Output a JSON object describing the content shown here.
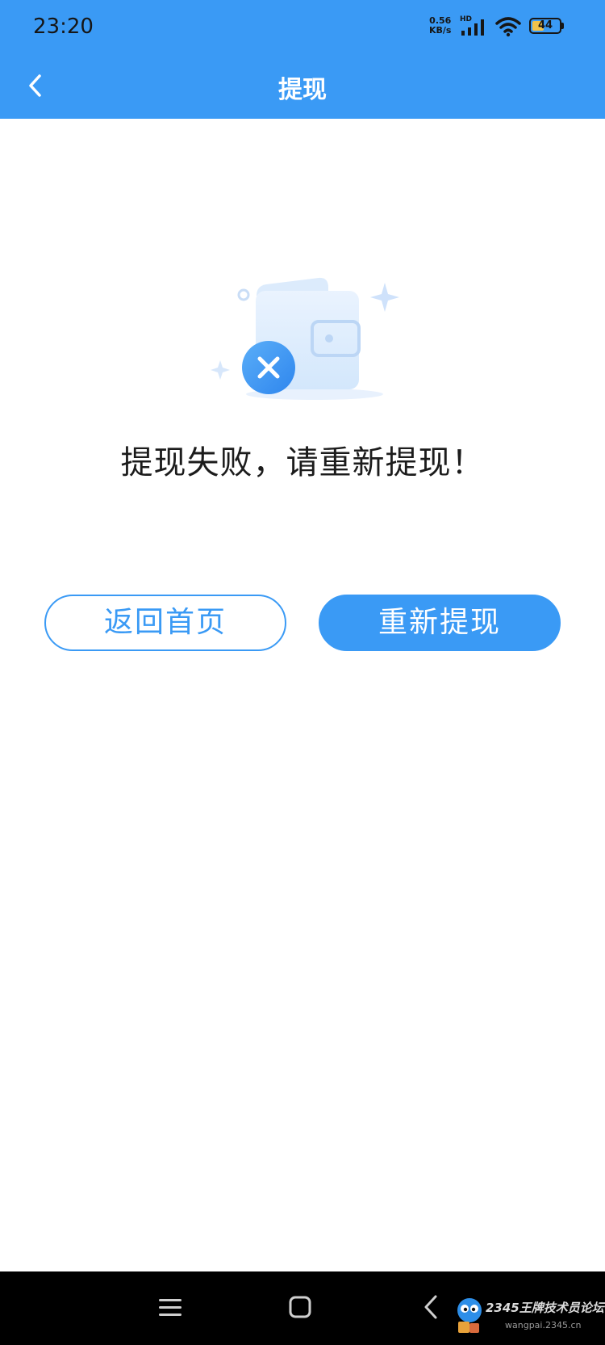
{
  "status_bar": {
    "time": "23:20",
    "net_speed_value": "0.56",
    "net_speed_unit": "KB/s",
    "network_type": "HD",
    "battery_level": "44",
    "battery_fraction": 0.44,
    "icons": [
      "signal-icon",
      "wifi-icon",
      "battery-icon"
    ]
  },
  "app_bar": {
    "title": "提现",
    "back_icon": "chevron-left-icon"
  },
  "main": {
    "illustration_icon": "wallet-failed-icon",
    "message": "提现失败，请重新提现！",
    "home_button_label": "返回首页",
    "retry_button_label": "重新提现"
  },
  "nav_bar": {
    "icons": [
      "menu-icon",
      "home-square-icon",
      "back-icon"
    ]
  },
  "watermark": {
    "title": "2345王牌技术员论坛",
    "url": "wangpai.2345.cn"
  },
  "colors": {
    "primary": "#3a9af5",
    "text": "#1c1c1c",
    "background": "#ffffff",
    "nav_background": "#000000"
  }
}
